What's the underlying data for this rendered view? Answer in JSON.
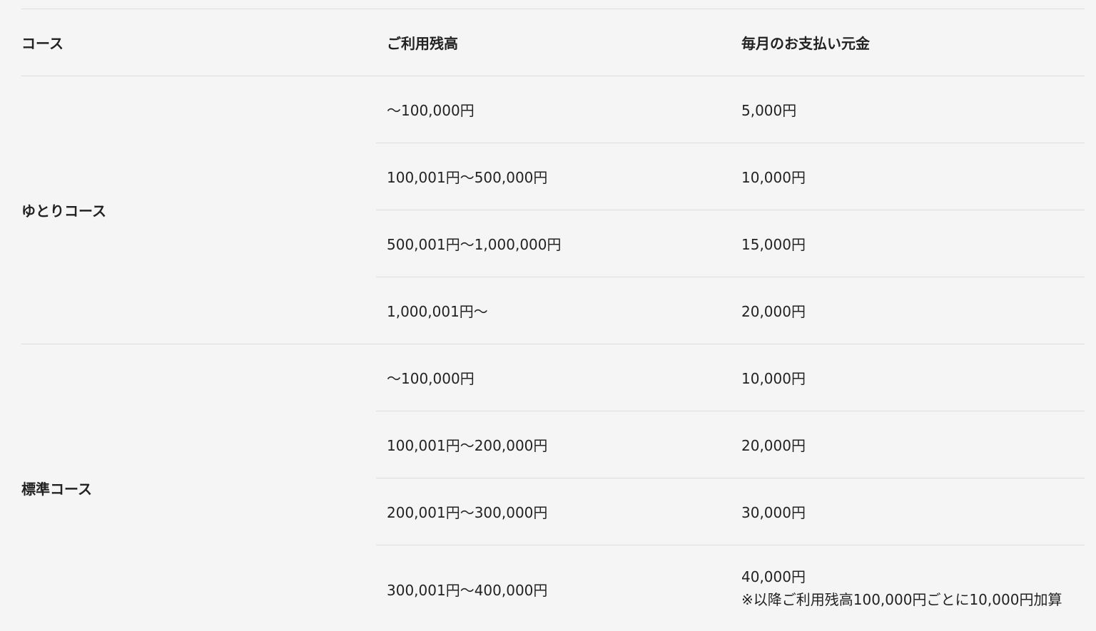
{
  "header": {
    "course": "コース",
    "balance": "ご利用残高",
    "payment": "毎月のお支払い元金"
  },
  "courses": [
    {
      "name": "ゆとりコース",
      "rows": [
        {
          "balance": "～100,000円",
          "payment": "5,000円"
        },
        {
          "balance": "100,001円～500,000円",
          "payment": "10,000円"
        },
        {
          "balance": "500,001円～1,000,000円",
          "payment": "15,000円"
        },
        {
          "balance": "1,000,001円～",
          "payment": "20,000円"
        }
      ]
    },
    {
      "name": "標準コース",
      "rows": [
        {
          "balance": "～100,000円",
          "payment": "10,000円"
        },
        {
          "balance": "100,001円～200,000円",
          "payment": "20,000円"
        },
        {
          "balance": "200,001円～300,000円",
          "payment": "30,000円"
        },
        {
          "balance": "300,001円～400,000円",
          "payment": "40,000円",
          "note": "※以降ご利用残高100,000円ごとに10,000円加算"
        }
      ]
    }
  ]
}
